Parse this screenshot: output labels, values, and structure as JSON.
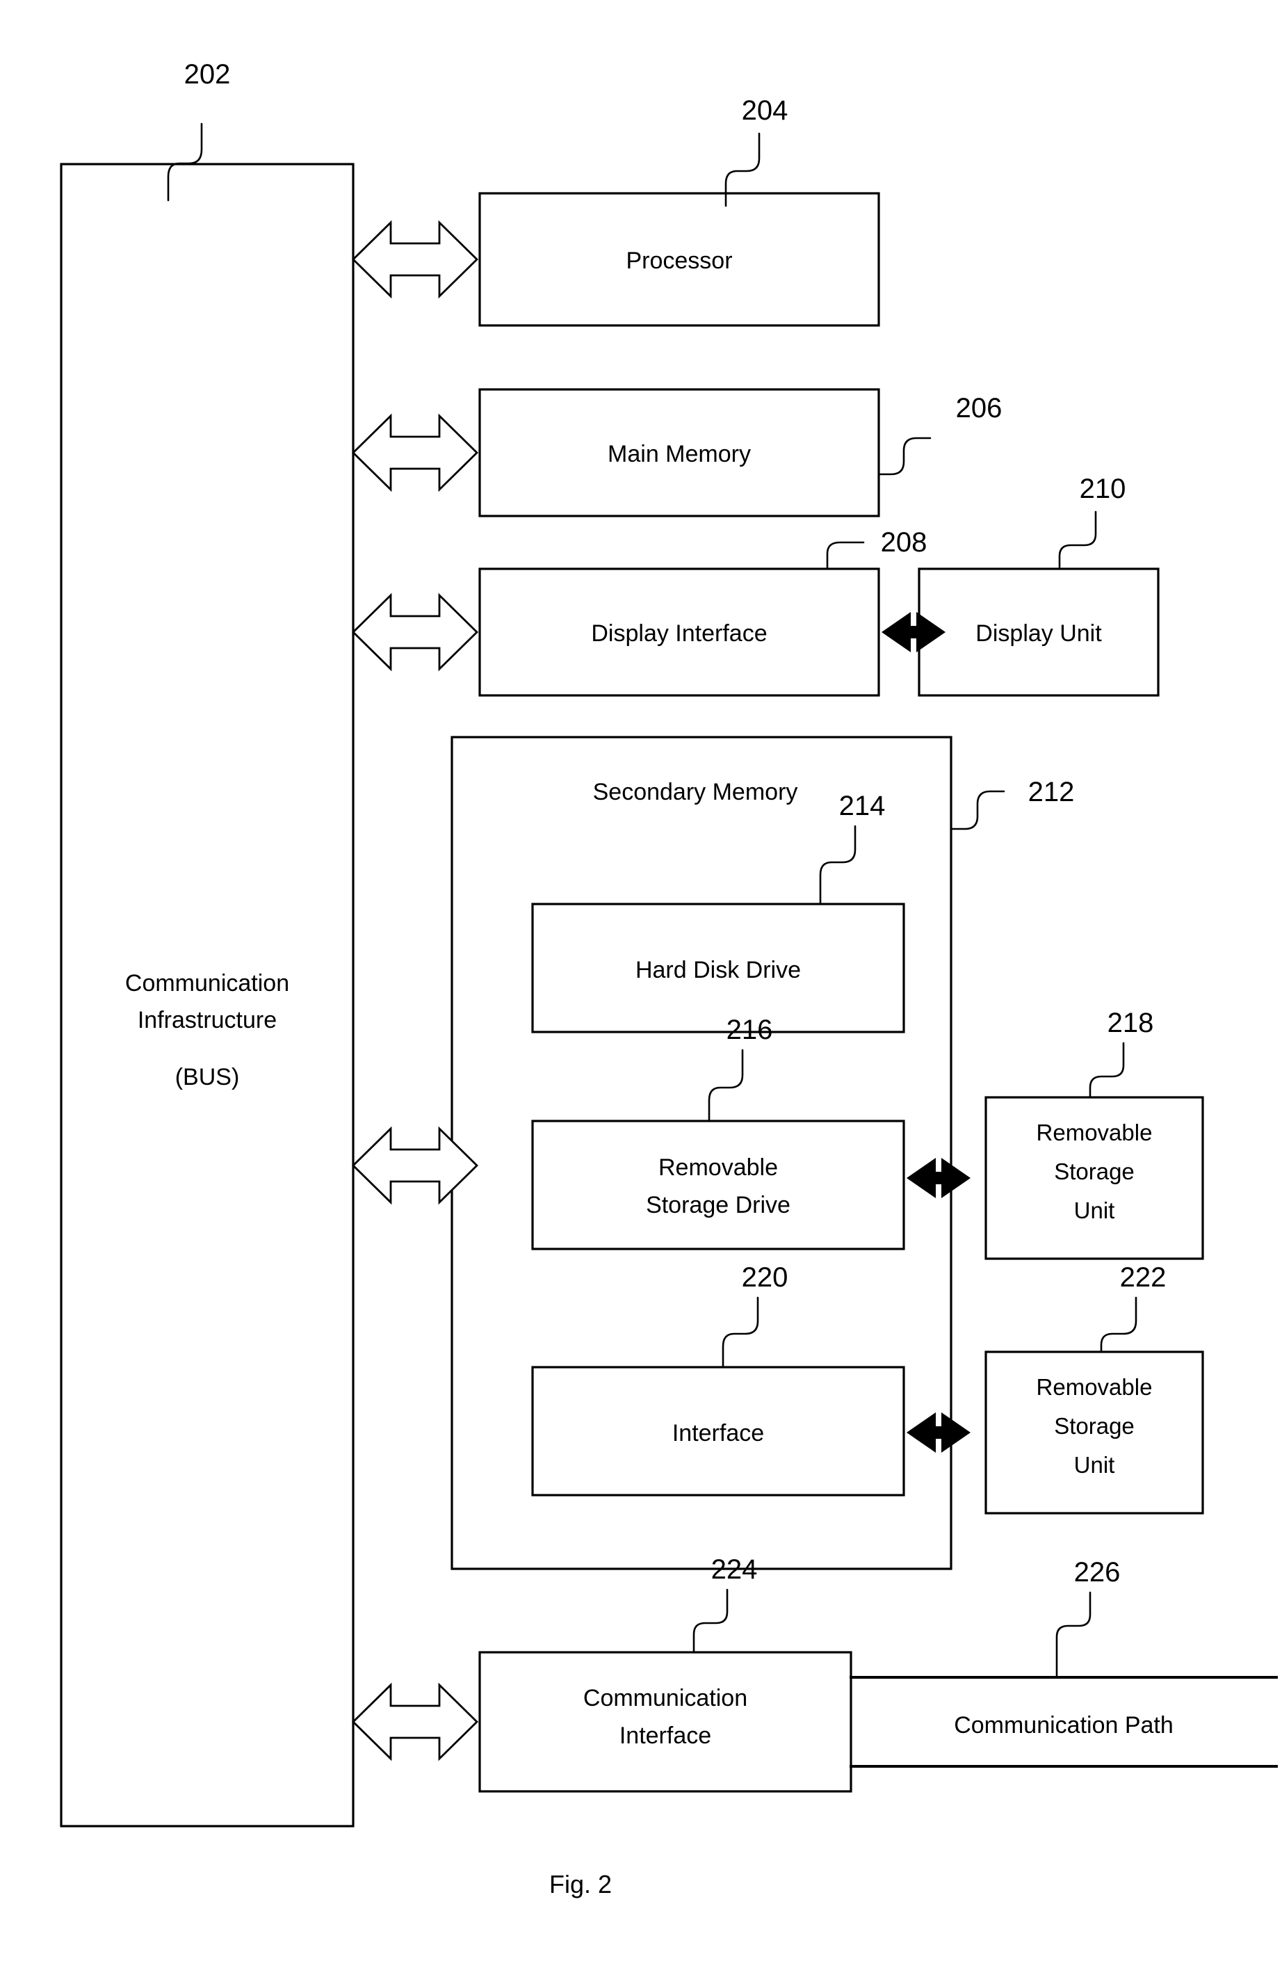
{
  "figure": {
    "caption": "Fig. 2",
    "type": "patent-block-diagram"
  },
  "bus": {
    "ref": "202",
    "line1": "Communication",
    "line2": "Infrastructure",
    "line3": "(BUS)"
  },
  "blocks": {
    "processor": {
      "ref": "204",
      "label": "Processor"
    },
    "main_memory": {
      "ref": "206",
      "label": "Main Memory"
    },
    "display_interface": {
      "ref": "208",
      "label": "Display Interface"
    },
    "display_unit": {
      "ref": "210",
      "label": "Display Unit"
    },
    "secondary_memory": {
      "ref": "212",
      "label": "Secondary Memory"
    },
    "hard_disk_drive": {
      "ref": "214",
      "label": "Hard Disk Drive"
    },
    "removable_storage_drive": {
      "ref": "216",
      "line1": "Removable",
      "line2": "Storage Drive"
    },
    "removable_storage_unit_1": {
      "ref": "218",
      "line1": "Removable",
      "line2": "Storage",
      "line3": "Unit"
    },
    "interface": {
      "ref": "220",
      "label": "Interface"
    },
    "removable_storage_unit_2": {
      "ref": "222",
      "line1": "Removable",
      "line2": "Storage",
      "line3": "Unit"
    },
    "communication_interface": {
      "ref": "224",
      "line1": "Communication",
      "line2": "Interface"
    },
    "communication_path": {
      "ref": "226",
      "label": "Communication Path"
    }
  },
  "colors": {
    "stroke": "#000000",
    "fill": "#ffffff",
    "background": "#ffffff"
  }
}
